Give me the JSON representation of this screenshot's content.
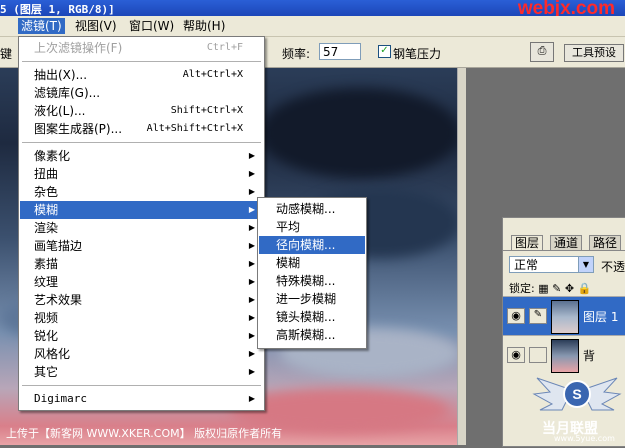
{
  "title_bar": {
    "text": "5 (图层 1, RGB/8)]",
    "watermark": "webjx.com"
  },
  "menubar": {
    "items": [
      "滤镜(T)",
      "视图(V)",
      "窗口(W)",
      "帮助(H)"
    ]
  },
  "options": {
    "frequency_label": "频率:",
    "frequency_value": "57",
    "pen_pressure_label": "钢笔压力",
    "tool_presets_label": "工具预设",
    "left_cut_label": "键"
  },
  "filter_menu": {
    "items": [
      {
        "label": "上次滤镜操作(F)",
        "shortcut": "Ctrl+F"
      },
      {
        "label": "抽出(X)...",
        "shortcut": "Alt+Ctrl+X"
      },
      {
        "label": "滤镜库(G)..."
      },
      {
        "label": "液化(L)...",
        "shortcut": "Shift+Ctrl+X"
      },
      {
        "label": "图案生成器(P)...",
        "shortcut": "Alt+Shift+Ctrl+X"
      },
      {
        "label": "像素化"
      },
      {
        "label": "扭曲"
      },
      {
        "label": "杂色"
      },
      {
        "label": "模糊"
      },
      {
        "label": "渲染"
      },
      {
        "label": "画笔描边"
      },
      {
        "label": "素描"
      },
      {
        "label": "纹理"
      },
      {
        "label": "艺术效果"
      },
      {
        "label": "视频"
      },
      {
        "label": "锐化"
      },
      {
        "label": "风格化"
      },
      {
        "label": "其它"
      },
      {
        "label": "Digimarc"
      }
    ]
  },
  "blur_submenu": {
    "items": [
      "动感模糊...",
      "平均",
      "径向模糊...",
      "模糊",
      "特殊模糊...",
      "进一步模糊",
      "镜头模糊...",
      "高斯模糊..."
    ]
  },
  "layers_panel": {
    "tabs": [
      "图层",
      "通道",
      "路径"
    ],
    "blend_mode": "正常",
    "opacity_label": "不透",
    "lock_label": "锁定:",
    "layers": [
      {
        "name": "图层 1"
      },
      {
        "name": "背"
      }
    ]
  },
  "footer": {
    "text": "上传于【新客网 WWW.XKER.COM】 版权归原作者所有"
  },
  "badge": {
    "text": "当月联盟",
    "url": "www.5yue.com"
  },
  "colors": {
    "highlight": "#316ac5",
    "menu_bg": "#ece9d8",
    "watermark": "#ff2a2a"
  }
}
